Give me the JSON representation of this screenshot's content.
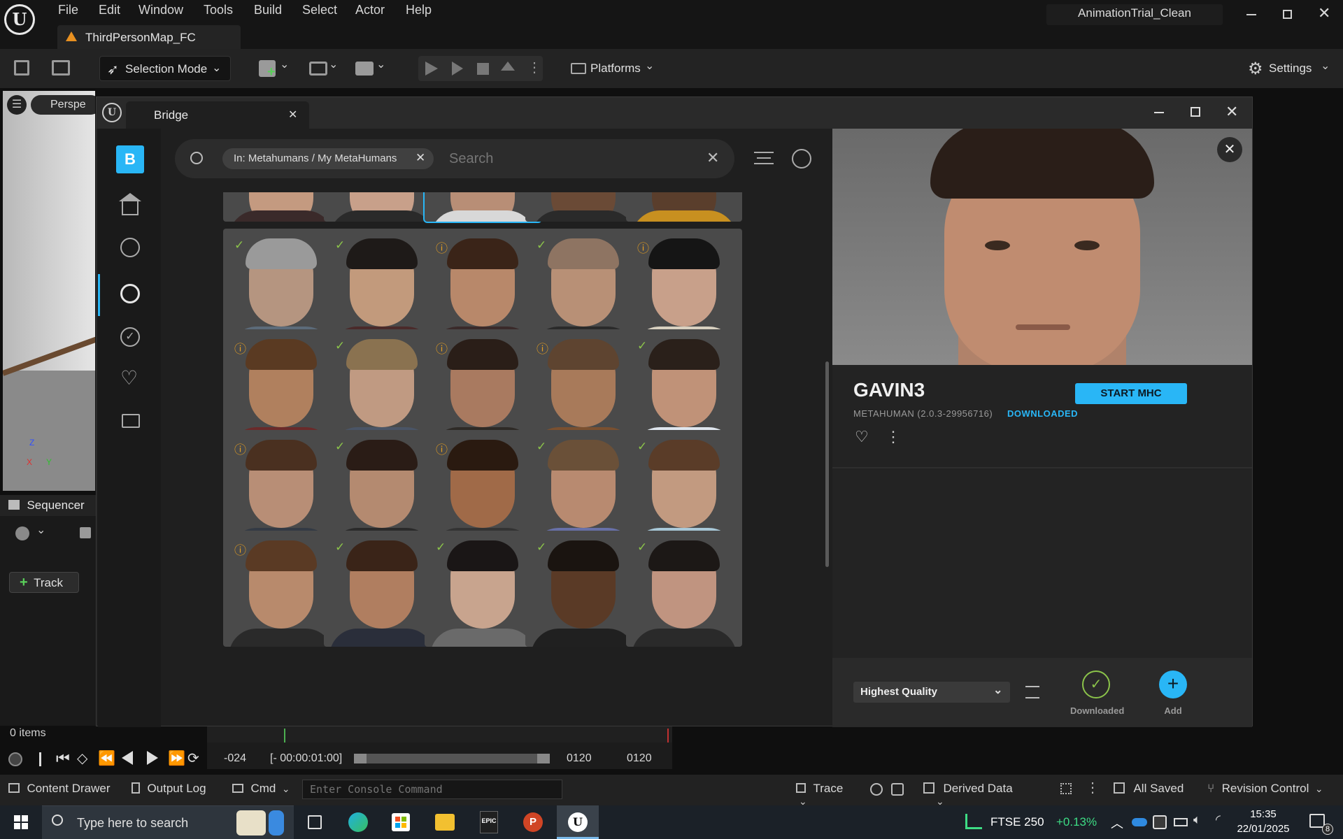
{
  "ue": {
    "menu": [
      "File",
      "Edit",
      "Window",
      "Tools",
      "Build",
      "Select",
      "Actor",
      "Help"
    ],
    "map_tab": "ThirdPersonMap_FC",
    "project_title": "AnimationTrial_Clean",
    "toolbar": {
      "selection_mode": "Selection Mode",
      "platforms": "Platforms",
      "settings": "Settings"
    },
    "viewport": {
      "perspective": "Perspe",
      "axis_z": "Z",
      "axis_x": "X",
      "axis_y": "Y"
    },
    "sequencer": {
      "title": "Sequencer",
      "track_button": "Track",
      "items_count": "0 items"
    },
    "timeline": {
      "start": "-024",
      "range": "[- 00:00:01:00]",
      "end1": "0120",
      "end2": "0120"
    },
    "bottom_bar": {
      "content_drawer": "Content Drawer",
      "output_log": "Output Log",
      "cmd": "Cmd",
      "console_placeholder": "Enter Console Command",
      "trace": "Trace",
      "derived_data": "Derived Data",
      "all_saved": "All Saved",
      "revision_control": "Revision Control"
    }
  },
  "bridge": {
    "tab_title": "Bridge",
    "search": {
      "filter_chip": "In: Metahumans / My MetaHumans",
      "placeholder": "Search"
    },
    "tiles": [
      {
        "status": "check",
        "skin": "#b59580",
        "hair": "#9a9a9a",
        "shirt": "#5c6b7a"
      },
      {
        "status": "check",
        "skin": "#c29a7c",
        "hair": "#1e1a18",
        "shirt": "#4a2a2a"
      },
      {
        "status": "info",
        "skin": "#b8886a",
        "hair": "#3a2418",
        "shirt": "#3a2a2a"
      },
      {
        "status": "check",
        "skin": "#b89076",
        "hair": "#8e7462",
        "shirt": "#2a2a2a"
      },
      {
        "status": "info",
        "skin": "#c8a08a",
        "hair": "#151515",
        "shirt": "#d8d0c0"
      },
      {
        "status": "info",
        "skin": "#b0805e",
        "hair": "#5a3a22",
        "shirt": "#6a2a2a"
      },
      {
        "status": "check",
        "skin": "#c09a82",
        "hair": "#8a7250",
        "shirt": "#4a5566"
      },
      {
        "status": "info",
        "skin": "#a97a60",
        "hair": "#2a1e18",
        "shirt": "#2e2a26"
      },
      {
        "status": "info",
        "skin": "#a87a5a",
        "hair": "#5e4430",
        "shirt": "#7a5030"
      },
      {
        "status": "check",
        "skin": "#c09278",
        "hair": "#2a201a",
        "shirt": "#dfe6ee"
      },
      {
        "status": "info",
        "skin": "#b88e76",
        "hair": "#4a3020",
        "shirt": "#333a44"
      },
      {
        "status": "check",
        "skin": "#b48a70",
        "hair": "#2a1c16",
        "shirt": "#2a2a2a"
      },
      {
        "status": "info",
        "skin": "#a06a48",
        "hair": "#2a1a10",
        "shirt": "#333333"
      },
      {
        "status": "check",
        "skin": "#b88a70",
        "hair": "#6a5038",
        "shirt": "#6870a8"
      },
      {
        "status": "check",
        "skin": "#c29a80",
        "hair": "#5a3c28",
        "shirt": "#a8c8d8"
      },
      {
        "status": "info",
        "skin": "#b88a6c",
        "hair": "#5a3a24",
        "shirt": "#2a2a2a"
      },
      {
        "status": "check",
        "skin": "#b07e60",
        "hair": "#3a2418",
        "shirt": "#2a2e3a"
      },
      {
        "status": "check",
        "skin": "#c8a48e",
        "hair": "#1a1616",
        "shirt": "#6a6a6a"
      },
      {
        "status": "check",
        "skin": "#5a3a26",
        "hair": "#1a1410",
        "shirt": "#202020"
      },
      {
        "status": "check",
        "skin": "#c09480",
        "hair": "#1c1816",
        "shirt": "#2a2a2a"
      }
    ],
    "detail": {
      "name": "GAVIN3",
      "subtitle": "METAHUMAN (2.0.3-29956716)",
      "status": "DOWNLOADED",
      "start_button": "START MHC",
      "quality": "Highest Quality",
      "downloaded_label": "Downloaded",
      "add_label": "Add"
    }
  },
  "taskbar": {
    "search_placeholder": "Type here to search",
    "ticker": "FTSE 250",
    "ticker_change": "+0.13%",
    "time": "15:35",
    "date": "22/01/2025",
    "notifications": "8"
  },
  "colors": {
    "accent_blue": "#29b6f6",
    "check_green": "#8bc34a",
    "info_orange": "#e8a020",
    "ticker_green": "#3ddc84"
  }
}
